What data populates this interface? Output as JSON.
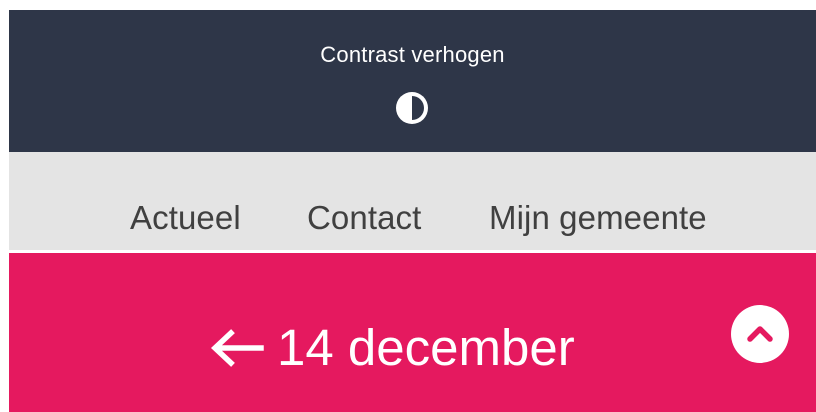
{
  "header": {
    "contrast_label": "Contrast verhogen",
    "contrast_icon": "half-circle-contrast-icon"
  },
  "nav": {
    "items": [
      {
        "label": "Actueel"
      },
      {
        "label": "Contact"
      },
      {
        "label": "Mijn gemeente"
      }
    ]
  },
  "hero": {
    "back_icon": "arrow-left-icon",
    "back_label": "14 december",
    "scroll_top_icon": "chevron-up-icon"
  },
  "colors": {
    "header_bg": "#2e3648",
    "nav_bg": "#e4e4e4",
    "nav_text": "#404040",
    "accent": "#e5195f",
    "on_accent": "#ffffff"
  }
}
